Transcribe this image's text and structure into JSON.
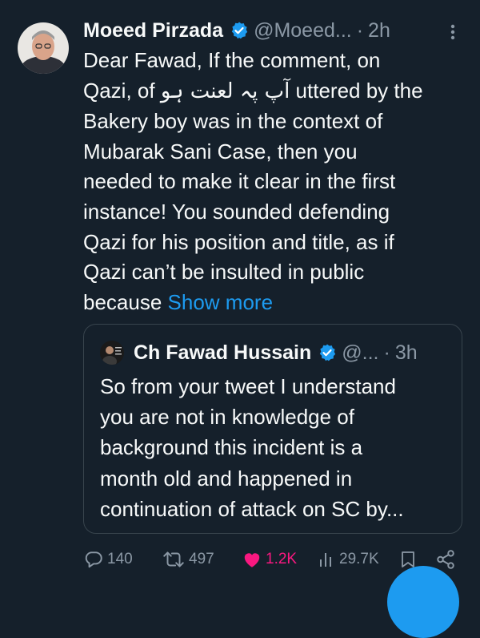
{
  "tweet": {
    "author_name": "Moeed Pirzada",
    "author_handle": "@Moeed...",
    "separator": "·",
    "time": "2h",
    "text_lines": [
      "Dear Fawad, If the comment, on",
      "Qazi, of",
      "آپ پہ لعنت ہو",
      "uttered by the",
      "Bakery boy was in the context of",
      "Mubarak Sani Case, then you",
      "needed to make it clear in the first",
      "instance! You sounded defending",
      "Qazi for his position and title, as if",
      "Qazi can’t be insulted in public",
      "because"
    ],
    "show_more": "Show more"
  },
  "quote": {
    "author_name": "Ch Fawad Hussain",
    "author_handle": "@...",
    "separator": "·",
    "time": "3h",
    "text_lines": [
      "So from your tweet I understand",
      "you are not in knowledge of",
      "background this incident is a",
      "month old and happened in",
      "continuation of attack on SC by..."
    ]
  },
  "actions": {
    "replies": "140",
    "retweets": "497",
    "likes": "1.2K",
    "views": "29.7K"
  },
  "colors": {
    "background": "#15202b",
    "text": "#f7f9f9",
    "secondary_text": "#8b98a5",
    "accent": "#1d9bf0",
    "like": "#f91880",
    "border": "#38444d"
  },
  "icons": {
    "verified": "verified-badge-icon",
    "more": "more-vertical-icon",
    "reply": "reply-icon",
    "retweet": "retweet-icon",
    "like": "heart-icon",
    "views": "views-icon",
    "bookmark": "bookmark-icon",
    "share": "share-icon",
    "compose": "compose-fab"
  }
}
